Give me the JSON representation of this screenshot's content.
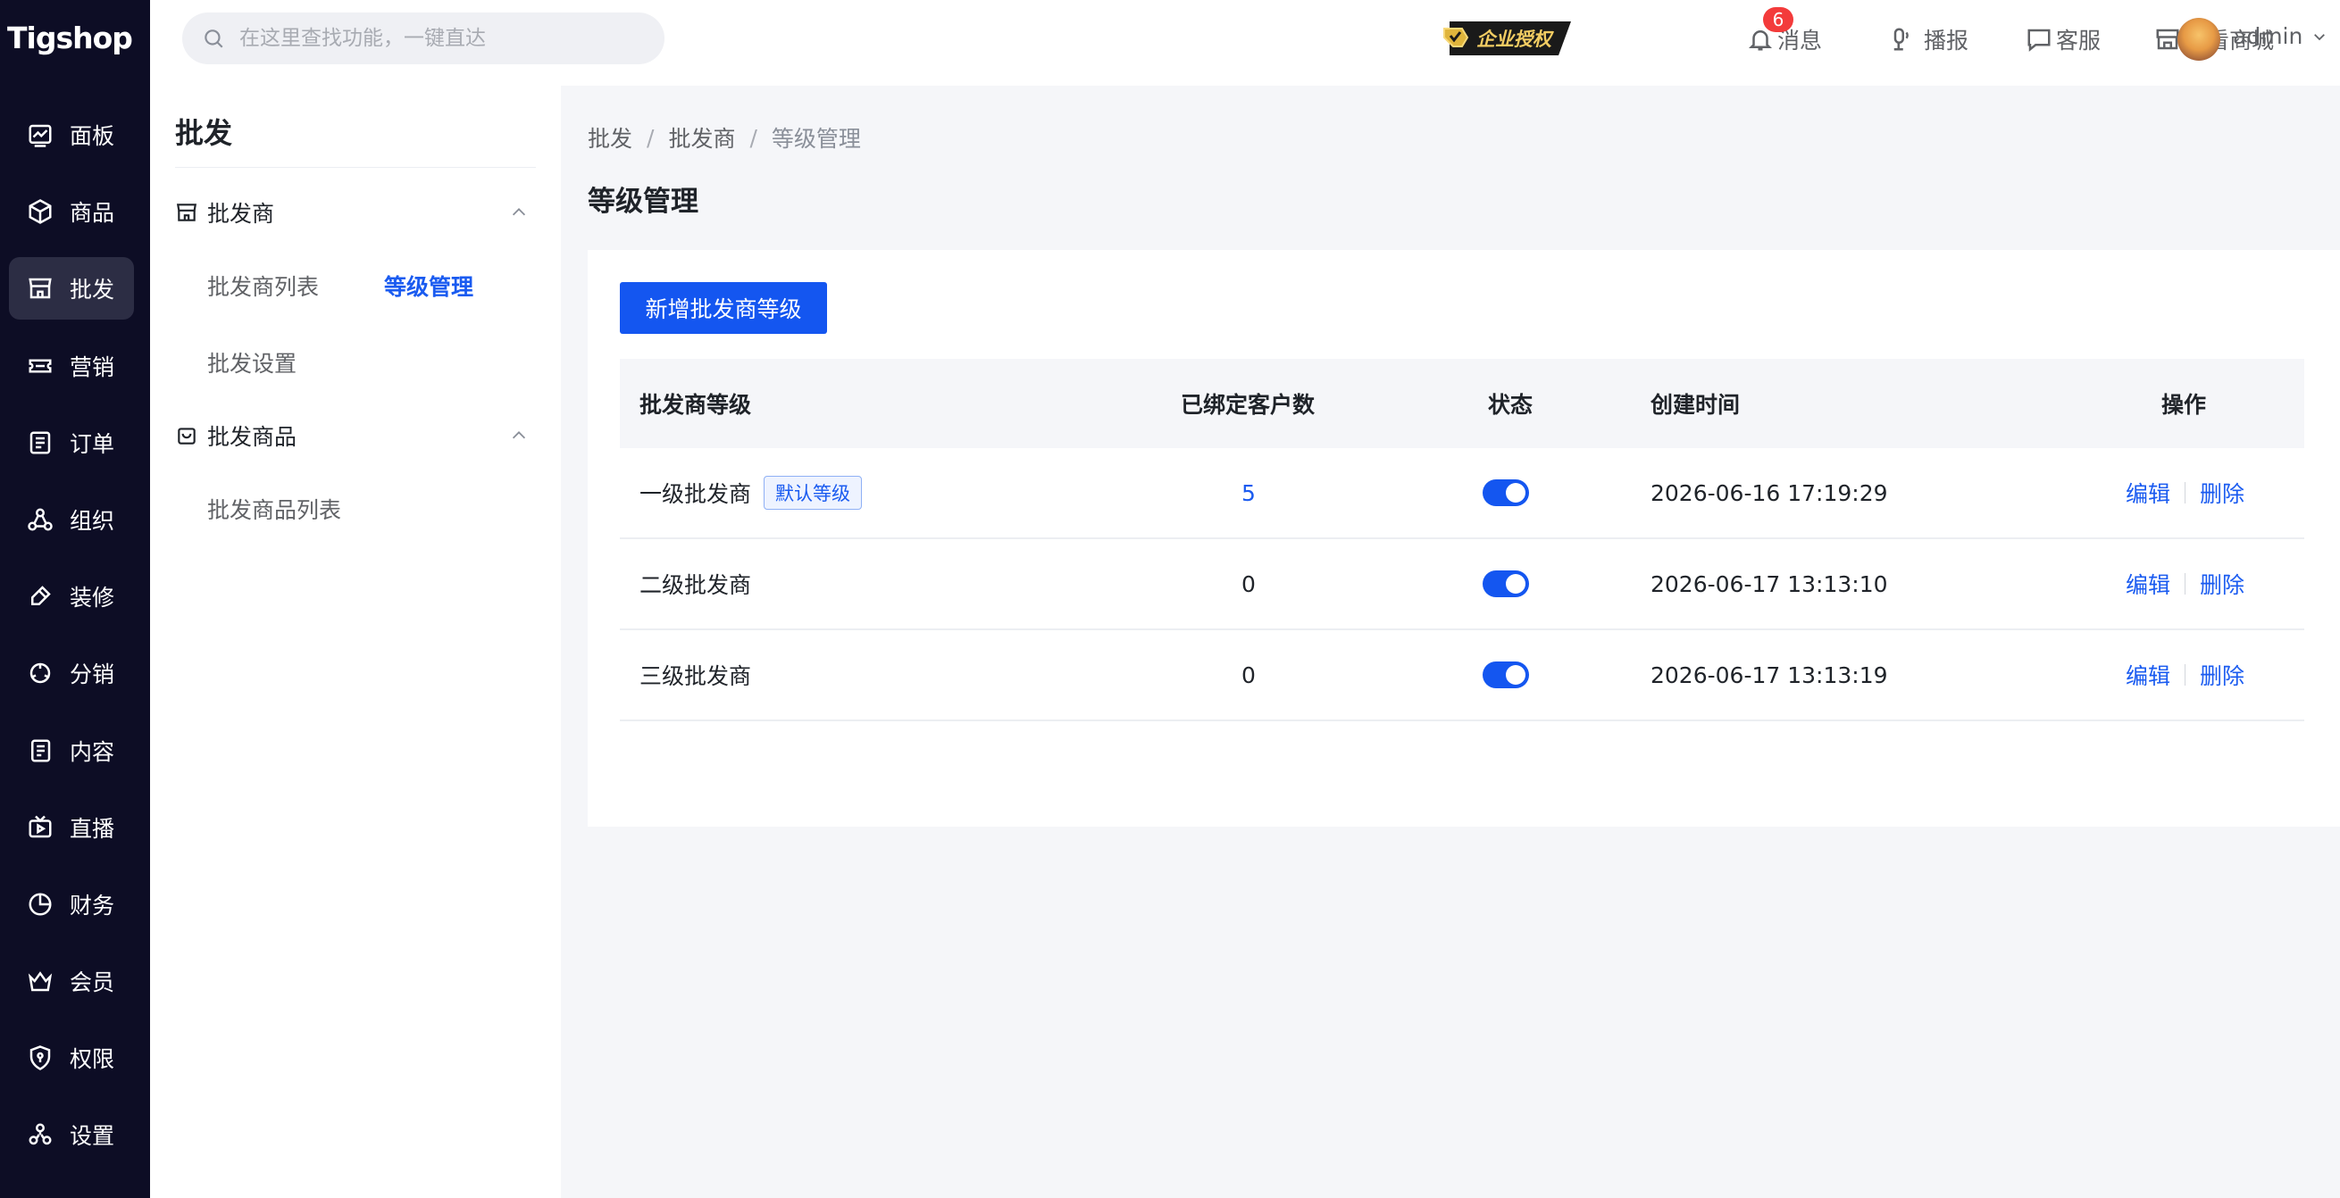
{
  "app": {
    "logo": "Tigshop"
  },
  "sidebar": {
    "items": [
      {
        "label": "面板",
        "icon": "dashboard-icon"
      },
      {
        "label": "商品",
        "icon": "product-icon"
      },
      {
        "label": "批发",
        "icon": "store-icon",
        "active": true
      },
      {
        "label": "营销",
        "icon": "ticket-icon"
      },
      {
        "label": "订单",
        "icon": "order-icon"
      },
      {
        "label": "组织",
        "icon": "organization-icon"
      },
      {
        "label": "装修",
        "icon": "brush-icon"
      },
      {
        "label": "分销",
        "icon": "distribution-icon"
      },
      {
        "label": "内容",
        "icon": "content-icon"
      },
      {
        "label": "直播",
        "icon": "live-icon"
      },
      {
        "label": "财务",
        "icon": "finance-icon"
      },
      {
        "label": "会员",
        "icon": "member-icon"
      },
      {
        "label": "权限",
        "icon": "permission-icon"
      },
      {
        "label": "设置",
        "icon": "settings-icon"
      }
    ]
  },
  "header": {
    "search_placeholder": "在这里查找功能，一键直达",
    "license_badge": "企业授权",
    "notice_count": "6",
    "notice_label": "消息",
    "broadcast_label": "播报",
    "service_label": "客服",
    "shop_label": "查看商城",
    "user_name": "admin"
  },
  "submenu": {
    "title": "批发",
    "groups": [
      {
        "label": "批发商",
        "links": [
          "批发商列表",
          "等级管理",
          "批发设置"
        ]
      },
      {
        "label": "批发商品",
        "links": [
          "批发商品列表"
        ]
      }
    ]
  },
  "breadcrumb": [
    "批发",
    "批发商",
    "等级管理"
  ],
  "page_title": "等级管理",
  "add_button": "新增批发商等级",
  "table": {
    "columns": [
      "批发商等级",
      "已绑定客户数",
      "状态",
      "创建时间",
      "操作"
    ],
    "rows": [
      {
        "name": "一级批发商",
        "tag": "默认等级",
        "count": "5",
        "enabled": true,
        "created": "2026-06-16 17:19:29"
      },
      {
        "name": "二级批发商",
        "count": "0",
        "enabled": true,
        "created": "2026-06-17 13:13:10"
      },
      {
        "name": "三级批发商",
        "count": "0",
        "enabled": true,
        "created": "2026-06-17 13:13:19"
      }
    ],
    "edit_label": "编辑",
    "delete_label": "删除"
  },
  "colors": {
    "sidebar_bg": "#0d0d25",
    "accent": "#1456f0",
    "badge_red": "#f33b3b"
  }
}
